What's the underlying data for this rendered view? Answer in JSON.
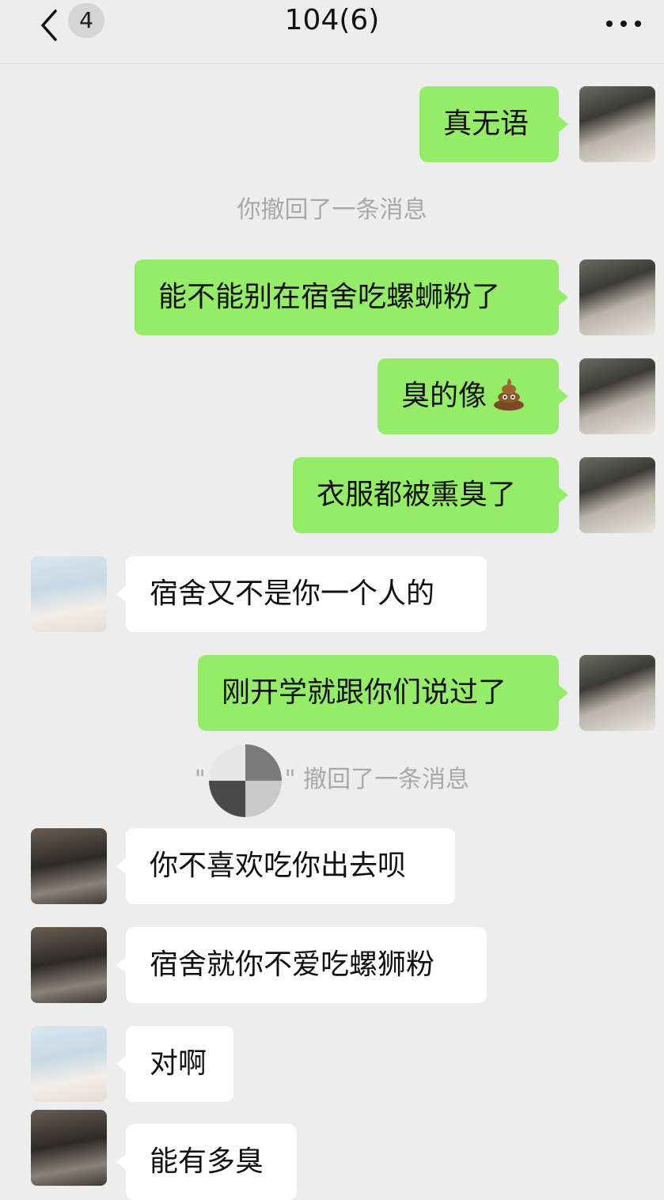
{
  "header": {
    "unread_count": "4",
    "title": "104(6)"
  },
  "messages": [
    {
      "text": "真无语"
    },
    {
      "system": "你撤回了一条消息"
    },
    {
      "text": "能不能别在宿舍吃螺蛳粉了"
    },
    {
      "text": "臭的像",
      "emoji": "poop-emoji"
    },
    {
      "text": "衣服都被熏臭了"
    },
    {
      "text": "宿舍又不是你一个人的"
    },
    {
      "text": "刚开学就跟你们说过了"
    },
    {
      "system_prefix": "\"",
      "system_suffix": "\" 撤回了一条消息"
    },
    {
      "text": "你不喜欢吃你出去呗"
    },
    {
      "text": "宿舍就你不爱吃螺狮粉"
    },
    {
      "text": "对啊"
    },
    {
      "text": "能有多臭"
    }
  ],
  "colors": {
    "outgoing_bubble": "#95ec69",
    "incoming_bubble": "#ffffff",
    "background": "#ededed"
  }
}
